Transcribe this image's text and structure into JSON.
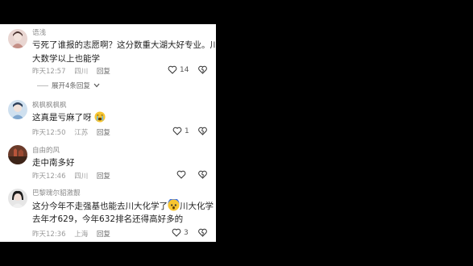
{
  "comments": [
    {
      "username": "语浅",
      "lines": [
        "亏死了谁报的志愿啊？这分数重大湖大好专业。川",
        "大数学以上也能学"
      ],
      "time": "昨天12:57",
      "location": "四川",
      "reply_label": "回复",
      "likes": "14",
      "expand_label": "展开4条回复"
    },
    {
      "username": "枫枫枫枫枫",
      "text": "这真是亏麻了呀",
      "time": "昨天12:50",
      "location": "江苏",
      "reply_label": "回复",
      "likes": "1"
    },
    {
      "username": "自由的风",
      "text": "走中南多好",
      "time": "昨天12:46",
      "location": "四川",
      "reply_label": "回复",
      "likes": ""
    },
    {
      "username": "巴黎瑰尔貂激靓",
      "line1_a": "这分今年不走强基也能去川大化学了",
      "line1_b": "川大化学",
      "line2": "去年才629，今年632排名还得高好多的",
      "time": "昨天12:36",
      "location": "上海",
      "reply_label": "回复",
      "likes": "3"
    }
  ]
}
